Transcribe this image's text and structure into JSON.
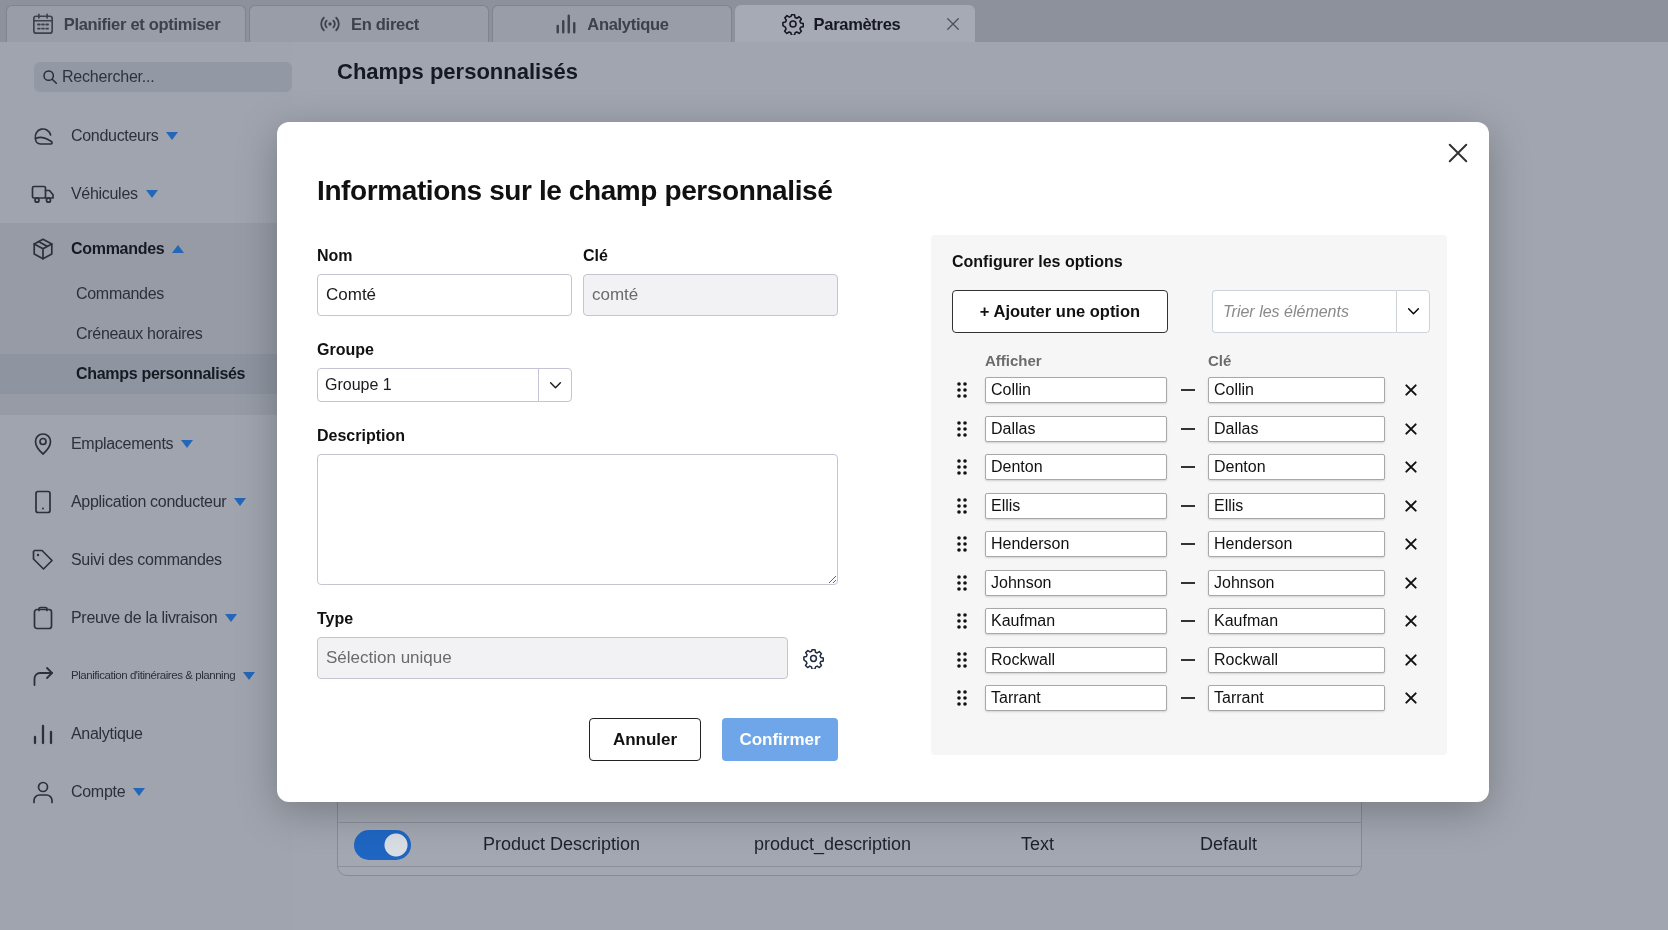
{
  "tabs": [
    {
      "label": "Planifier et optimiser",
      "selected": false
    },
    {
      "label": "En direct",
      "selected": false
    },
    {
      "label": "Analytique",
      "selected": false
    },
    {
      "label": "Paramètres",
      "selected": true
    }
  ],
  "search": {
    "placeholder": "Rechercher..."
  },
  "sidebar": {
    "items": [
      {
        "label": "Conducteurs",
        "kind": "group",
        "expanded": false
      },
      {
        "label": "Véhicules",
        "kind": "group",
        "expanded": false
      },
      {
        "label": "Commandes",
        "kind": "group",
        "expanded": true,
        "children": [
          {
            "label": "Commandes",
            "selected": false
          },
          {
            "label": "Créneaux horaires",
            "selected": false
          },
          {
            "label": "Champs personnalisés",
            "selected": true
          }
        ]
      },
      {
        "label": "Emplacements",
        "kind": "group",
        "expanded": false
      },
      {
        "label": "Application conducteur",
        "kind": "group",
        "expanded": false
      },
      {
        "label": "Suivi des commandes",
        "kind": "link"
      },
      {
        "label": "Preuve de la livraison",
        "kind": "group",
        "expanded": false
      },
      {
        "label": "Planification d'itinéraires & planning",
        "kind": "group",
        "expanded": false
      },
      {
        "label": "Analytique",
        "kind": "link"
      },
      {
        "label": "Compte",
        "kind": "group",
        "expanded": false
      }
    ]
  },
  "page": {
    "title": "Champs personnalisés"
  },
  "table": {
    "rows": [
      {
        "on": true,
        "cells": [
          "Product Description",
          "product_description",
          "Text",
          "Default"
        ]
      }
    ]
  },
  "dialog": {
    "title": "Informations sur le champ personnalisé",
    "fields": [
      {
        "kind": "text",
        "label": "Nom",
        "value": "Comté",
        "disabled": false
      },
      {
        "kind": "text",
        "label": "Clé",
        "value": "comté",
        "disabled": true
      },
      {
        "kind": "select",
        "label": "Groupe",
        "value": "Groupe 1"
      },
      {
        "kind": "textarea",
        "label": "Description"
      },
      {
        "kind": "configurable",
        "label": "Type",
        "value": "Sélection unique",
        "disabled": true
      }
    ],
    "buttons": [
      {
        "label": "Annuler",
        "kind": "secondary",
        "disabled": false
      },
      {
        "label": "Confirmer",
        "kind": "primary",
        "disabled": true
      }
    ],
    "options": {
      "title": "Configurer les options",
      "add_label": "+ Ajouter une option",
      "sort_placeholder": "Trier les éléments",
      "columns": [
        "Afficher",
        "Clé"
      ],
      "rows": [
        {
          "display": "Collin",
          "key": "Collin"
        },
        {
          "display": "Dallas",
          "key": "Dallas"
        },
        {
          "display": "Denton",
          "key": "Denton"
        },
        {
          "display": "Ellis",
          "key": "Ellis"
        },
        {
          "display": "Henderson",
          "key": "Henderson"
        },
        {
          "display": "Johnson",
          "key": "Johnson"
        },
        {
          "display": "Kaufman",
          "key": "Kaufman"
        },
        {
          "display": "Rockwall",
          "key": "Rockwall"
        },
        {
          "display": "Tarrant",
          "key": "Tarrant"
        }
      ]
    }
  }
}
